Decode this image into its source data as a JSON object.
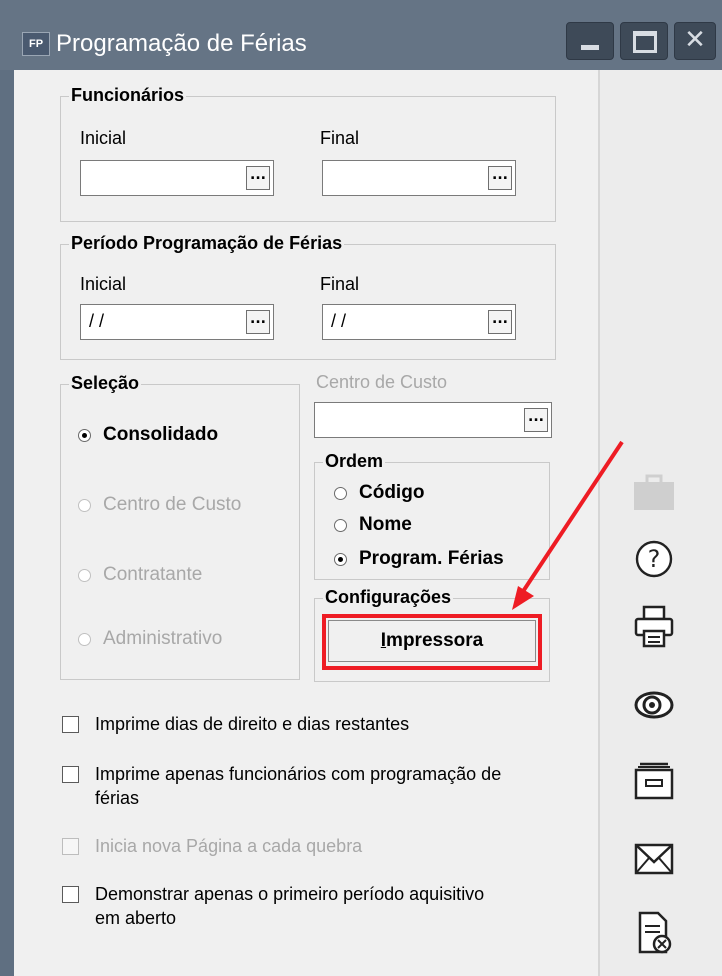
{
  "window": {
    "icon_text": "FP",
    "title": "Programação de Férias",
    "close_glyph": "✕"
  },
  "funcionarios": {
    "title": "Funcionários",
    "inicial_label": "Inicial",
    "inicial_value": "",
    "final_label": "Final",
    "final_value": ""
  },
  "periodo": {
    "title": "Período Programação de Férias",
    "inicial_label": "Inicial",
    "inicial_value": " /  /",
    "final_label": "Final",
    "final_value": " /  /"
  },
  "selecao": {
    "title": "Seleção",
    "options": [
      {
        "label": "Consolidado",
        "checked": true,
        "enabled": true
      },
      {
        "label": "Centro de Custo",
        "checked": false,
        "enabled": false
      },
      {
        "label": "Contratante",
        "checked": false,
        "enabled": false
      },
      {
        "label": "Administrativo",
        "checked": false,
        "enabled": false
      }
    ]
  },
  "centro_custo": {
    "label": "Centro de Custo",
    "value": ""
  },
  "ordem": {
    "title": "Ordem",
    "options": [
      {
        "label": "Código",
        "checked": false
      },
      {
        "label": "Nome",
        "checked": false
      },
      {
        "label": "Program. Férias",
        "checked": true
      }
    ]
  },
  "configuracoes": {
    "title": "Configurações",
    "button_label_first": "I",
    "button_label_rest": "mpressora"
  },
  "checkboxes": [
    {
      "label": "Imprime dias de direito e dias restantes",
      "checked": false,
      "enabled": true
    },
    {
      "label": "Imprime apenas funcionários com programação de férias",
      "checked": false,
      "enabled": true
    },
    {
      "label": "Inicia nova Página a cada quebra",
      "checked": false,
      "enabled": false
    },
    {
      "label": "Demonstrar apenas o primeiro período aquisitivo em aberto",
      "checked": false,
      "enabled": true
    }
  ],
  "sidebar_icons": [
    "briefcase-icon",
    "help-icon",
    "printer-icon",
    "preview-eye-icon",
    "archive-drawer-icon",
    "envelope-icon",
    "document-export-icon"
  ],
  "ellipsis": "...",
  "colors": {
    "highlight": "#ee1c24",
    "titlebar": "#657485",
    "client": "#f0f0f0"
  }
}
